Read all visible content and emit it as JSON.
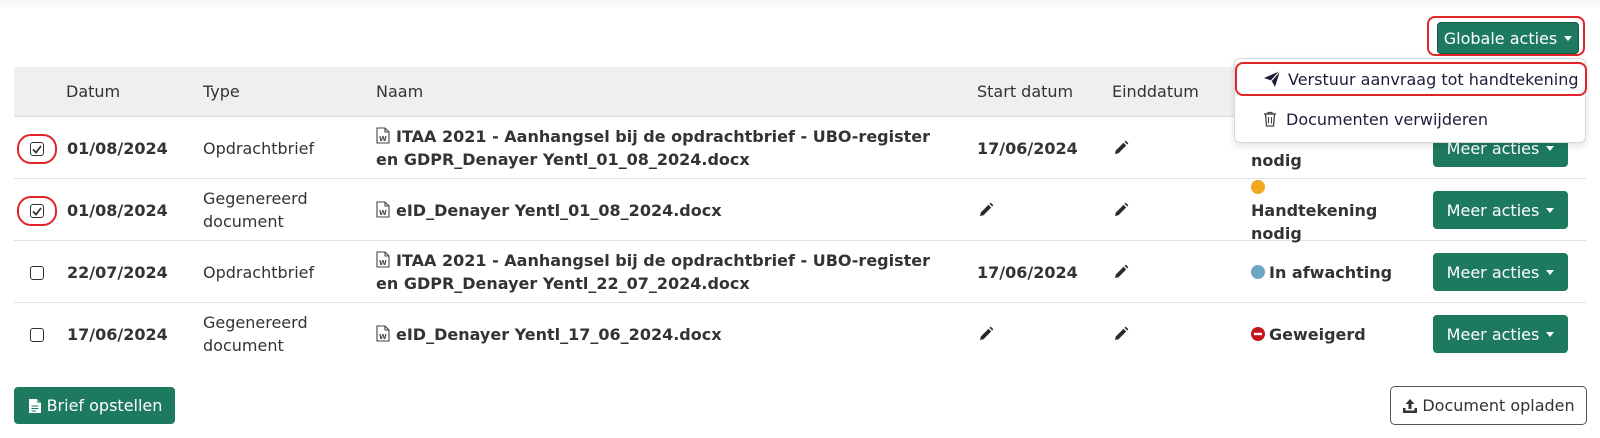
{
  "global_actions": {
    "label": "Globale acties"
  },
  "dropdown": {
    "items": [
      {
        "label": "Verstuur aanvraag tot handtekening",
        "icon": "paper-plane-icon"
      },
      {
        "label": "Documenten verwijderen",
        "icon": "trash-icon"
      }
    ]
  },
  "table": {
    "headers": {
      "date": "Datum",
      "type": "Type",
      "name": "Naam",
      "start": "Start datum",
      "end": "Einddatum"
    },
    "rows": [
      {
        "checked": true,
        "date": "01/08/2024",
        "type": "Opdrachtbrief",
        "name": "ITAA 2021 - Aanhangsel bij de opdrachtbrief - UBO-register en GDPR_Denayer Yentl_01_08_2024.docx",
        "start": "17/06/2024",
        "status": "nodig",
        "status_color": "",
        "action": "Meer acties"
      },
      {
        "checked": true,
        "date": "01/08/2024",
        "type": "Gegenereerd document",
        "name": "eID_Denayer Yentl_01_08_2024.docx",
        "start": "",
        "status": "Handtekening nodig",
        "status_color": "#f0a81c",
        "action": "Meer acties"
      },
      {
        "checked": false,
        "date": "22/07/2024",
        "type": "Opdrachtbrief",
        "name": "ITAA 2021 - Aanhangsel bij de opdrachtbrief - UBO-register en GDPR_Denayer Yentl_22_07_2024.docx",
        "start": "17/06/2024",
        "status": "In afwachting",
        "status_color": "#6fa6c8",
        "action": "Meer acties"
      },
      {
        "checked": false,
        "date": "17/06/2024",
        "type": "Gegenereerd document",
        "name": "eID_Denayer Yentl_17_06_2024.docx",
        "start": "",
        "status": "Geweigerd",
        "status_color": "#c4161c",
        "action": "Meer acties"
      }
    ]
  },
  "footer": {
    "brief_button": "Brief opstellen",
    "upload_button": "Document opladen"
  },
  "colors": {
    "primary": "#1d7a5f",
    "highlight": "#e0262b"
  }
}
